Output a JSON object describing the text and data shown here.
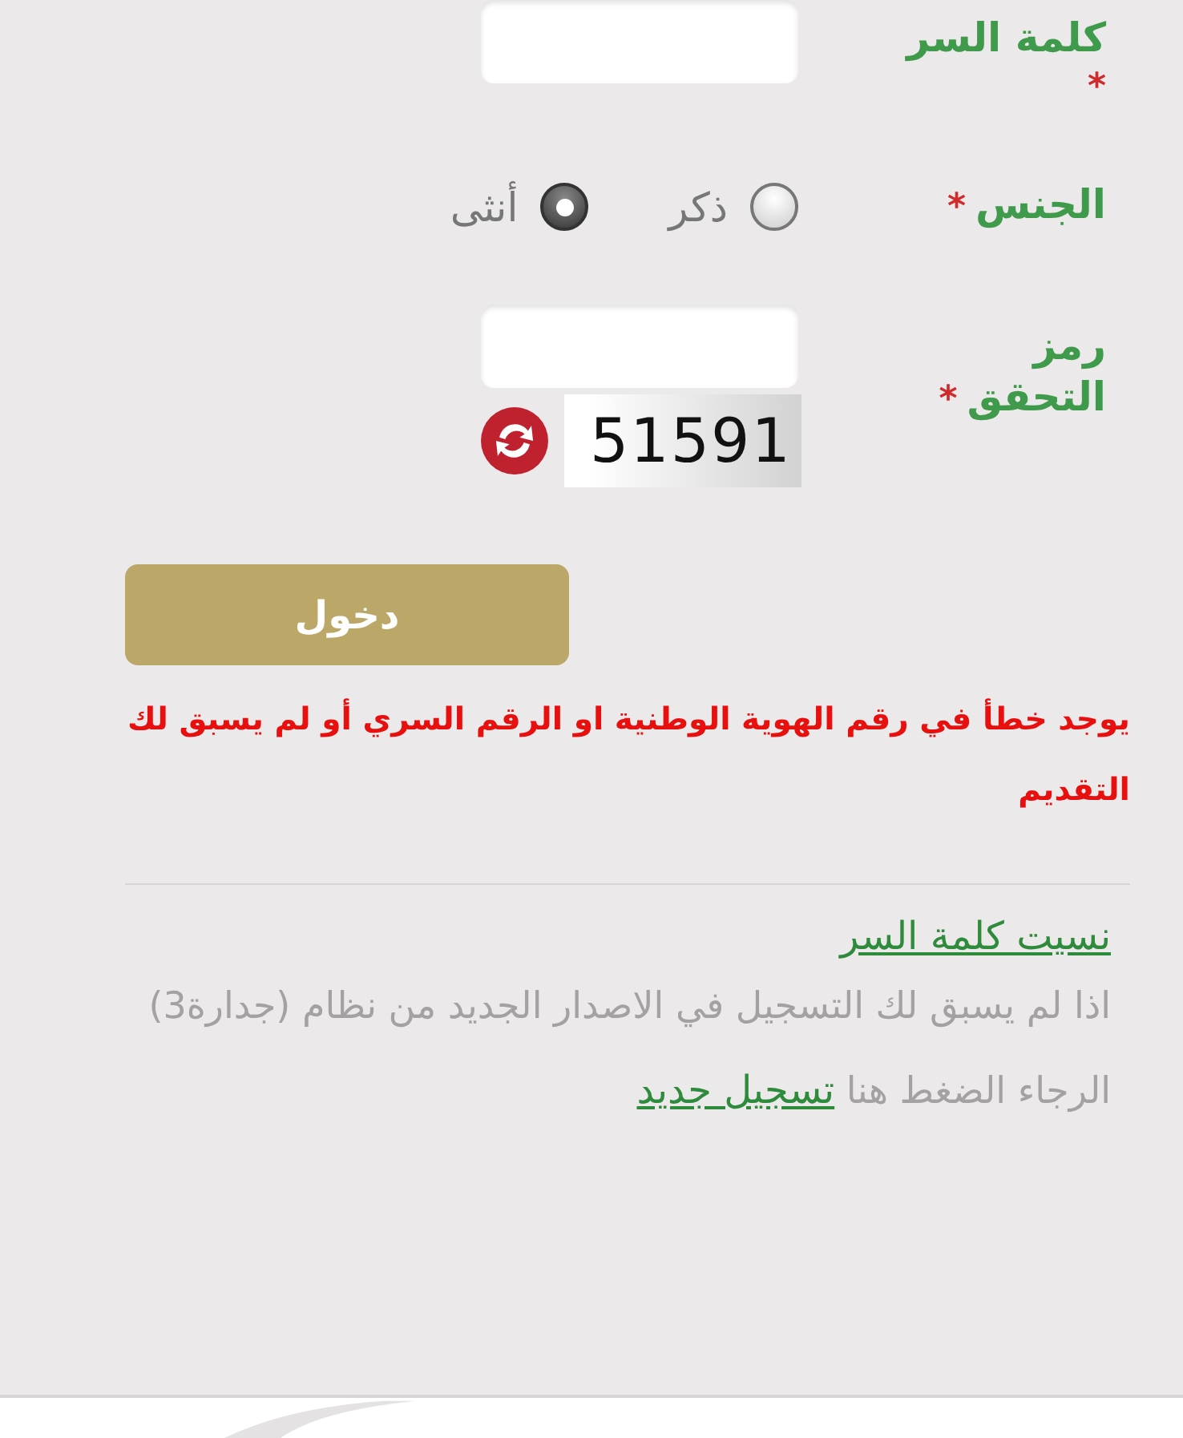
{
  "fields": [
    {
      "kind": "password",
      "label": "كلمة السر",
      "required_mark": "*"
    },
    {
      "kind": "gender",
      "label": "الجنس",
      "required_mark": "*",
      "options": [
        {
          "label": "ذكر",
          "selected": false
        },
        {
          "label": "أنثى",
          "selected": true
        }
      ]
    },
    {
      "kind": "captcha",
      "label_lines": [
        "رمز",
        "التحقق"
      ],
      "required_mark": "*",
      "code": "51591"
    }
  ],
  "login_button": "دخول",
  "error": "يوجد خطأ في رقم الهوية الوطنية او الرقم السري أو لم يسبق لك التقديم",
  "forgot_link": "نسيت كلمة السر",
  "register_note": {
    "text": "اذا لم يسبق لك التسجيل في الاصدار الجديد من نظام (جدارة3) الرجاء الضغط هنا",
    "link": "تسجيل جديد"
  }
}
